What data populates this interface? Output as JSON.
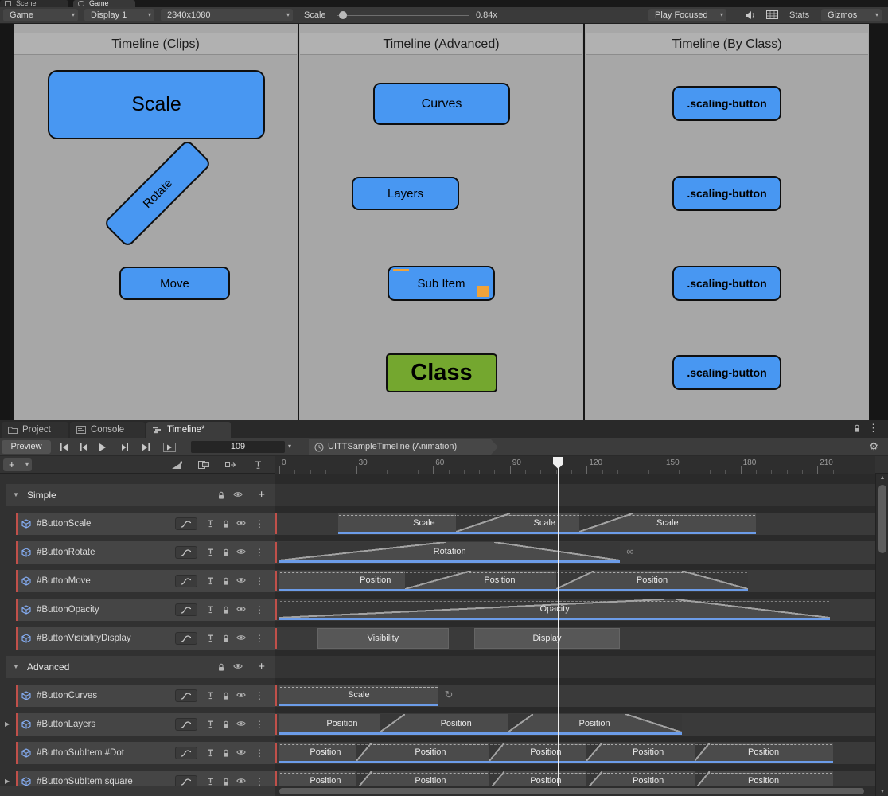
{
  "editor_tabs": [
    {
      "label": "Scene"
    },
    {
      "label": "Game"
    }
  ],
  "game_toolbar": {
    "view": "Game",
    "display": "Display 1",
    "resolution": "2340x1080",
    "sc4ale": "",
    "scale_label": "Scale",
    "scale_value": "0.84x",
    "play_focused": "Play Focused",
    "stats": "Stats",
    "gizmos": "Gizmos"
  },
  "game_view": {
    "panels": [
      {
        "title": "Timeline (Clips)"
      },
      {
        "title": "Timeline (Advanced)"
      },
      {
        "title": "Timeline (By Class)"
      }
    ],
    "buttons": {
      "scale": "Scale",
      "rotate": "Rotate",
      "move": "Move",
      "curves": "Curves",
      "layers": "Layers",
      "sub_item": "Sub Item",
      "class": "Class",
      "scaling": ".scaling-button"
    }
  },
  "timeline": {
    "tabs": [
      {
        "label": "Project"
      },
      {
        "label": "Console"
      },
      {
        "label": "Timeline*"
      }
    ],
    "preview": "Preview",
    "frame": "109",
    "breadcrumb": "UITTSampleTimeline (Animation)",
    "playhead_frame": 109,
    "ruler": {
      "start": 0,
      "end": 216,
      "step": 30,
      "labels": [
        "0",
        "30",
        "60",
        "90",
        "120",
        "150",
        "180",
        "210"
      ]
    },
    "rows": [
      {
        "type": "group",
        "label": "Simple"
      },
      {
        "type": "track",
        "label": "#ButtonScale",
        "clips": [
          {
            "label": "Scale",
            "start": 23,
            "end": 90,
            "fadeOut": 20
          },
          {
            "label": "Scale",
            "start": 69,
            "end": 138,
            "fadeIn": 21,
            "fadeOut": 21
          },
          {
            "label": "Scale",
            "start": 117,
            "end": 186,
            "fadeIn": 21
          }
        ]
      },
      {
        "type": "track",
        "label": "#ButtonRotate",
        "clips": [
          {
            "label": "Rotation",
            "start": 0,
            "end": 133,
            "fadeIn": 65,
            "fadeOut": 49,
            "marker": "∞"
          }
        ]
      },
      {
        "type": "track",
        "label": "#ButtonMove",
        "clips": [
          {
            "label": "Position",
            "start": 0,
            "end": 75,
            "fadeOut": 26
          },
          {
            "label": "Position",
            "start": 49,
            "end": 123,
            "fadeIn": 26,
            "fadeOut": 15
          },
          {
            "label": "Position",
            "start": 108,
            "end": 183,
            "fadeIn": 15,
            "fadeOut": 26
          }
        ]
      },
      {
        "type": "track",
        "label": "#ButtonOpacity",
        "clips": [
          {
            "label": "Opacity",
            "start": 0,
            "end": 215,
            "fadeIn": 150,
            "fadeOut": 60
          }
        ]
      },
      {
        "type": "track",
        "label": "#ButtonVisibilityDisplay",
        "clips": [
          {
            "label": "Visibility",
            "start": 15,
            "end": 66,
            "plain": true
          },
          {
            "label": "Display",
            "start": 76,
            "end": 133,
            "plain": true
          }
        ]
      },
      {
        "type": "group",
        "label": "Advanced"
      },
      {
        "type": "track",
        "label": "#ButtonCurves",
        "clips": [
          {
            "label": "Scale",
            "start": 0,
            "end": 62,
            "marker": "↻"
          }
        ]
      },
      {
        "type": "track",
        "label": "#ButtonLayers",
        "expander": true,
        "clips": [
          {
            "label": "Position",
            "start": 0,
            "end": 49,
            "fadeOut": 10
          },
          {
            "label": "Position",
            "start": 39,
            "end": 99,
            "fadeIn": 10,
            "fadeOut": 10
          },
          {
            "label": "Position",
            "start": 89,
            "end": 157,
            "fadeIn": 10,
            "fadeOut": 22
          }
        ]
      },
      {
        "type": "track",
        "label": "#ButtonSubItem #Dot",
        "clips": [
          {
            "label": "Position",
            "start": 0,
            "end": 36,
            "fadeOut": 6
          },
          {
            "label": "Position",
            "start": 30,
            "end": 88,
            "fadeIn": 6,
            "fadeOut": 6
          },
          {
            "label": "Position",
            "start": 82,
            "end": 126,
            "fadeIn": 6,
            "fadeOut": 6
          },
          {
            "label": "Position",
            "start": 120,
            "end": 168,
            "fadeIn": 6,
            "fadeOut": 6
          },
          {
            "label": "Position",
            "start": 162,
            "end": 216,
            "fadeIn": 6
          }
        ]
      },
      {
        "type": "track",
        "label": "#ButtonSubItem square",
        "expander": true,
        "clips": [
          {
            "label": "Position",
            "start": 0,
            "end": 36,
            "fadeOut": 6
          },
          {
            "label": "Position",
            "start": 30,
            "end": 88,
            "fadeIn": 6,
            "fadeOut": 6
          },
          {
            "label": "Position",
            "start": 82,
            "end": 126,
            "fadeIn": 6,
            "fadeOut": 6
          },
          {
            "label": "Position",
            "start": 120,
            "end": 168,
            "fadeIn": 6,
            "fadeOut": 6
          },
          {
            "label": "Position",
            "start": 162,
            "end": 216,
            "fadeIn": 6
          }
        ]
      }
    ]
  },
  "icons": {
    "caret": "▾",
    "collapse": "▼",
    "expand": "▶",
    "kebab": "⋮",
    "gear": "⚙",
    "plus": "+",
    "scroll_up": "▲",
    "scroll_down": "▼"
  },
  "colors": {
    "button_blue": "#4897F2",
    "button_green": "#74A72F",
    "clip_underline": "#6C9CE8",
    "marker_orange": "#F0A33A",
    "track_stripe": "#C0504A"
  }
}
